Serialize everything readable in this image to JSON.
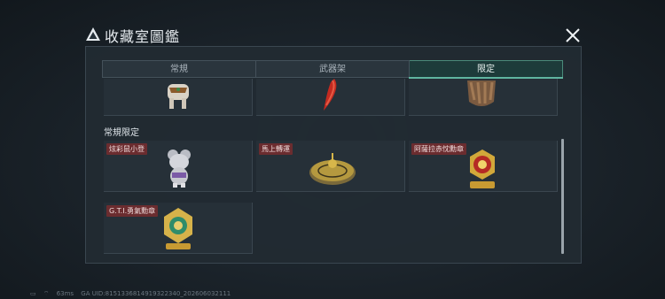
{
  "window": {
    "title": "收藏室圖鑑"
  },
  "tabs": [
    {
      "label": "常規",
      "active": false
    },
    {
      "label": "武器架",
      "active": false
    },
    {
      "label": "限定",
      "active": true
    }
  ],
  "top_row_items": [
    {
      "icon": "animal-figurine-icon"
    },
    {
      "icon": "red-pepper-icon"
    },
    {
      "icon": "bronze-gauntlet-icon"
    }
  ],
  "section": {
    "title": "常規限定"
  },
  "items": [
    {
      "name": "炫彩鼠小登",
      "icon": "mouse-figurine-icon"
    },
    {
      "name": "馬上轉運",
      "icon": "golden-compass-icon"
    },
    {
      "name": "阿薩拉赤忱勳章",
      "icon": "medal-icon"
    },
    {
      "name": "G.T.I.勇氣勳章",
      "icon": "courage-medal-icon"
    }
  ],
  "footer": {
    "ping": "63ms",
    "uid": "GA UID:8151336814919322340_202606032111"
  },
  "colors": {
    "accent": "#5fb5a0",
    "label_bg": "#6b2c2f",
    "panel_bg": "#212b32"
  }
}
